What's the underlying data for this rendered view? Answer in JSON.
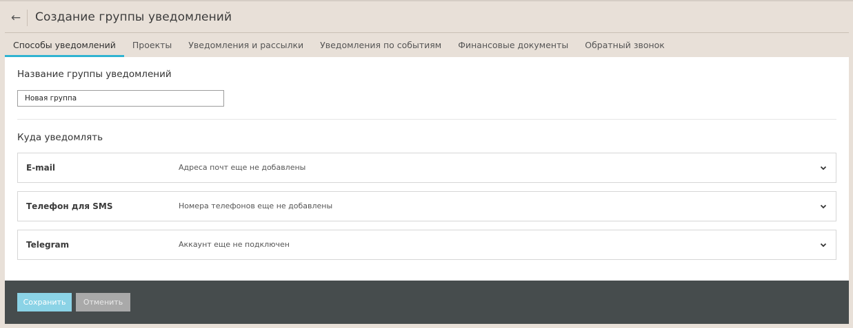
{
  "header": {
    "back_icon": "arrow-left-icon",
    "title": "Создание группы уведомлений"
  },
  "tabs": [
    {
      "label": "Способы уведомлений",
      "active": true
    },
    {
      "label": "Проекты",
      "active": false
    },
    {
      "label": "Уведомления и рассылки",
      "active": false
    },
    {
      "label": "Уведомления по событиям",
      "active": false
    },
    {
      "label": "Финансовые документы",
      "active": false
    },
    {
      "label": "Обратный звонок",
      "active": false
    }
  ],
  "form": {
    "name_section_title": "Название группы уведомлений",
    "name_value": "Новая группа",
    "targets_section_title": "Куда уведомлять",
    "targets": [
      {
        "label": "E-mail",
        "status": "Адреса почт еще не добавлены"
      },
      {
        "label": "Телефон для SMS",
        "status": "Номера телефонов еще не добавлены"
      },
      {
        "label": "Telegram",
        "status": "Аккаунт еще не подключен"
      }
    ]
  },
  "footer": {
    "save_label": "Сохранить",
    "cancel_label": "Отменить"
  },
  "colors": {
    "accent": "#2eb3d1",
    "page_bg": "#e8e0d8",
    "footer_bg": "#464c4d",
    "save_bg": "#8bd3e6",
    "cancel_bg": "#a9a9a9"
  }
}
